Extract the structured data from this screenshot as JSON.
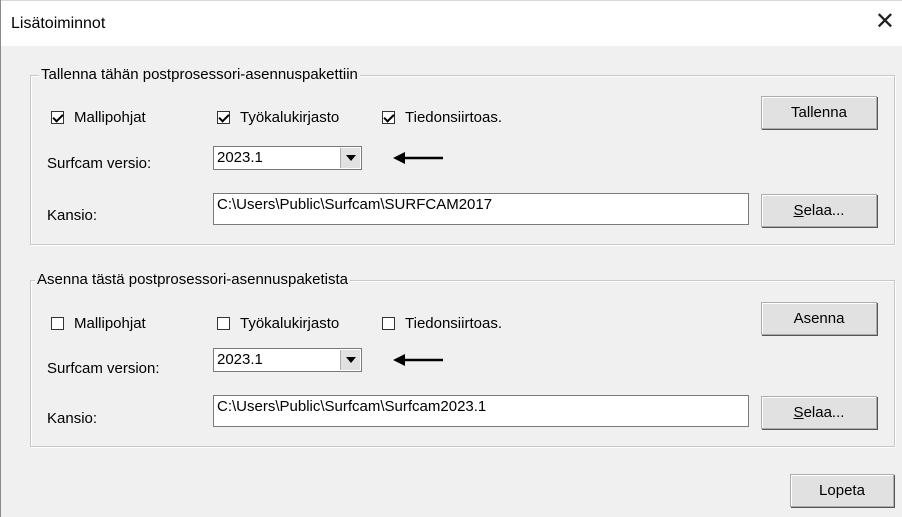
{
  "window": {
    "title": "Lisätoiminnot"
  },
  "save_group": {
    "legend": "Tallenna tähän postprosessori-asennuspakettiin",
    "checkboxes": [
      {
        "label": "Mallipohjat",
        "checked": true
      },
      {
        "label": "Työkalukirjasto",
        "checked": true
      },
      {
        "label": "Tiedonsiirtoas.",
        "checked": true
      }
    ],
    "version_label": "Surfcam versio:",
    "version_value": "2023.1",
    "folder_label": "Kansio:",
    "folder_value": "C:\\Users\\Public\\Surfcam\\SURFCAM2017",
    "action_button": "Tallenna",
    "browse_button": {
      "mnemonic": "S",
      "rest": "elaa..."
    }
  },
  "install_group": {
    "legend": "Asenna tästä postprosessori-asennuspaketista",
    "checkboxes": [
      {
        "label": "Mallipohjat",
        "checked": false
      },
      {
        "label": "Työkalukirjasto",
        "checked": false
      },
      {
        "label": "Tiedonsiirtoas.",
        "checked": false
      }
    ],
    "version_label": "Surfcam version:",
    "version_value": "2023.1",
    "folder_label": "Kansio:",
    "folder_value": "C:\\Users\\Public\\Surfcam\\Surfcam2023.1",
    "action_button": "Asenna",
    "browse_button": {
      "mnemonic": "S",
      "rest": "elaa..."
    }
  },
  "footer": {
    "close_button": "Lopeta"
  },
  "icons": {
    "close": "close-icon",
    "annotation": "arrow-left-icon",
    "dropdown": "chevron-down-icon"
  }
}
